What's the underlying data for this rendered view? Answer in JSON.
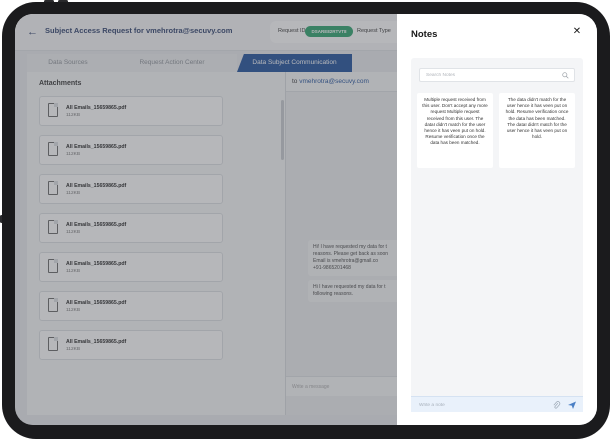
{
  "app": {
    "title": "Subject Access Request for vmehrotra@secuvy.com",
    "request_id_label": "Request ID",
    "request_id_value": "DSARE82RTVT8",
    "request_type_label": "Request Type"
  },
  "tabs": [
    {
      "label": "Data Sources",
      "active": false
    },
    {
      "label": "Request Action Center",
      "active": false
    },
    {
      "label": "Data Subject Communication",
      "active": true
    }
  ],
  "attachments": {
    "heading": "Attachments",
    "files": [
      {
        "name": "All Emails_15659865.pdf",
        "size": "112KB"
      },
      {
        "name": "All Emails_15659865.pdf",
        "size": "112KB"
      },
      {
        "name": "All Emails_15659865.pdf",
        "size": "112KB"
      },
      {
        "name": "All Emails_15659865.pdf",
        "size": "112KB"
      },
      {
        "name": "All Emails_15659865.pdf",
        "size": "112KB"
      },
      {
        "name": "All Emails_15659865.pdf",
        "size": "112KB"
      },
      {
        "name": "All Emails_15659865.pdf",
        "size": "112KB"
      }
    ]
  },
  "chat": {
    "to_label": "to",
    "to_email": "vmehrotra@secuvy.com",
    "messages": [
      {
        "lines": [
          "Hi! I have requested my data for t",
          "reasons. Please get back as soon",
          "Email is vmehrotra@gmail.co",
          "+91-9865201468"
        ]
      },
      {
        "lines": [
          "Hi I have requested my data for t",
          "following reasons."
        ]
      }
    ],
    "input_placeholder": "Write a message"
  },
  "notes": {
    "title": "Notes",
    "search_placeholder": "Search Notes",
    "cards": [
      {
        "text": "Multiple request received from this user. Don't accept any more request Multiple request received from this user. The dataI didn't match for the user hence it has veen put on hold. Resume verification once the data has been matched."
      },
      {
        "text": "The data didn't match for the user hence it has veen put on hold. Resume verification once the data has been matched. The dataI didn't match for the user hence it has veen put on hold."
      }
    ],
    "write_placeholder": "Write a note"
  }
}
